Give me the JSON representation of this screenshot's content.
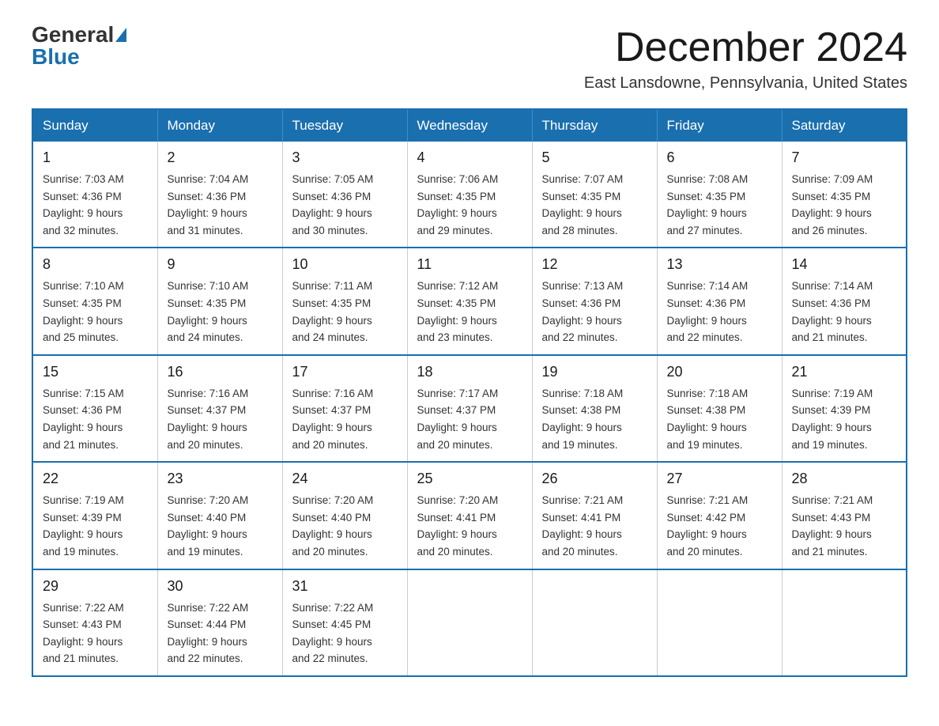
{
  "header": {
    "logo_general": "General",
    "logo_blue": "Blue",
    "title": "December 2024",
    "subtitle": "East Lansdowne, Pennsylvania, United States"
  },
  "weekdays": [
    "Sunday",
    "Monday",
    "Tuesday",
    "Wednesday",
    "Thursday",
    "Friday",
    "Saturday"
  ],
  "weeks": [
    [
      {
        "day": "1",
        "sunrise": "7:03 AM",
        "sunset": "4:36 PM",
        "daylight": "9 hours and 32 minutes."
      },
      {
        "day": "2",
        "sunrise": "7:04 AM",
        "sunset": "4:36 PM",
        "daylight": "9 hours and 31 minutes."
      },
      {
        "day": "3",
        "sunrise": "7:05 AM",
        "sunset": "4:36 PM",
        "daylight": "9 hours and 30 minutes."
      },
      {
        "day": "4",
        "sunrise": "7:06 AM",
        "sunset": "4:35 PM",
        "daylight": "9 hours and 29 minutes."
      },
      {
        "day": "5",
        "sunrise": "7:07 AM",
        "sunset": "4:35 PM",
        "daylight": "9 hours and 28 minutes."
      },
      {
        "day": "6",
        "sunrise": "7:08 AM",
        "sunset": "4:35 PM",
        "daylight": "9 hours and 27 minutes."
      },
      {
        "day": "7",
        "sunrise": "7:09 AM",
        "sunset": "4:35 PM",
        "daylight": "9 hours and 26 minutes."
      }
    ],
    [
      {
        "day": "8",
        "sunrise": "7:10 AM",
        "sunset": "4:35 PM",
        "daylight": "9 hours and 25 minutes."
      },
      {
        "day": "9",
        "sunrise": "7:10 AM",
        "sunset": "4:35 PM",
        "daylight": "9 hours and 24 minutes."
      },
      {
        "day": "10",
        "sunrise": "7:11 AM",
        "sunset": "4:35 PM",
        "daylight": "9 hours and 24 minutes."
      },
      {
        "day": "11",
        "sunrise": "7:12 AM",
        "sunset": "4:35 PM",
        "daylight": "9 hours and 23 minutes."
      },
      {
        "day": "12",
        "sunrise": "7:13 AM",
        "sunset": "4:36 PM",
        "daylight": "9 hours and 22 minutes."
      },
      {
        "day": "13",
        "sunrise": "7:14 AM",
        "sunset": "4:36 PM",
        "daylight": "9 hours and 22 minutes."
      },
      {
        "day": "14",
        "sunrise": "7:14 AM",
        "sunset": "4:36 PM",
        "daylight": "9 hours and 21 minutes."
      }
    ],
    [
      {
        "day": "15",
        "sunrise": "7:15 AM",
        "sunset": "4:36 PM",
        "daylight": "9 hours and 21 minutes."
      },
      {
        "day": "16",
        "sunrise": "7:16 AM",
        "sunset": "4:37 PM",
        "daylight": "9 hours and 20 minutes."
      },
      {
        "day": "17",
        "sunrise": "7:16 AM",
        "sunset": "4:37 PM",
        "daylight": "9 hours and 20 minutes."
      },
      {
        "day": "18",
        "sunrise": "7:17 AM",
        "sunset": "4:37 PM",
        "daylight": "9 hours and 20 minutes."
      },
      {
        "day": "19",
        "sunrise": "7:18 AM",
        "sunset": "4:38 PM",
        "daylight": "9 hours and 19 minutes."
      },
      {
        "day": "20",
        "sunrise": "7:18 AM",
        "sunset": "4:38 PM",
        "daylight": "9 hours and 19 minutes."
      },
      {
        "day": "21",
        "sunrise": "7:19 AM",
        "sunset": "4:39 PM",
        "daylight": "9 hours and 19 minutes."
      }
    ],
    [
      {
        "day": "22",
        "sunrise": "7:19 AM",
        "sunset": "4:39 PM",
        "daylight": "9 hours and 19 minutes."
      },
      {
        "day": "23",
        "sunrise": "7:20 AM",
        "sunset": "4:40 PM",
        "daylight": "9 hours and 19 minutes."
      },
      {
        "day": "24",
        "sunrise": "7:20 AM",
        "sunset": "4:40 PM",
        "daylight": "9 hours and 20 minutes."
      },
      {
        "day": "25",
        "sunrise": "7:20 AM",
        "sunset": "4:41 PM",
        "daylight": "9 hours and 20 minutes."
      },
      {
        "day": "26",
        "sunrise": "7:21 AM",
        "sunset": "4:41 PM",
        "daylight": "9 hours and 20 minutes."
      },
      {
        "day": "27",
        "sunrise": "7:21 AM",
        "sunset": "4:42 PM",
        "daylight": "9 hours and 20 minutes."
      },
      {
        "day": "28",
        "sunrise": "7:21 AM",
        "sunset": "4:43 PM",
        "daylight": "9 hours and 21 minutes."
      }
    ],
    [
      {
        "day": "29",
        "sunrise": "7:22 AM",
        "sunset": "4:43 PM",
        "daylight": "9 hours and 21 minutes."
      },
      {
        "day": "30",
        "sunrise": "7:22 AM",
        "sunset": "4:44 PM",
        "daylight": "9 hours and 22 minutes."
      },
      {
        "day": "31",
        "sunrise": "7:22 AM",
        "sunset": "4:45 PM",
        "daylight": "9 hours and 22 minutes."
      },
      null,
      null,
      null,
      null
    ]
  ],
  "labels": {
    "sunrise": "Sunrise:",
    "sunset": "Sunset:",
    "daylight": "Daylight:"
  }
}
